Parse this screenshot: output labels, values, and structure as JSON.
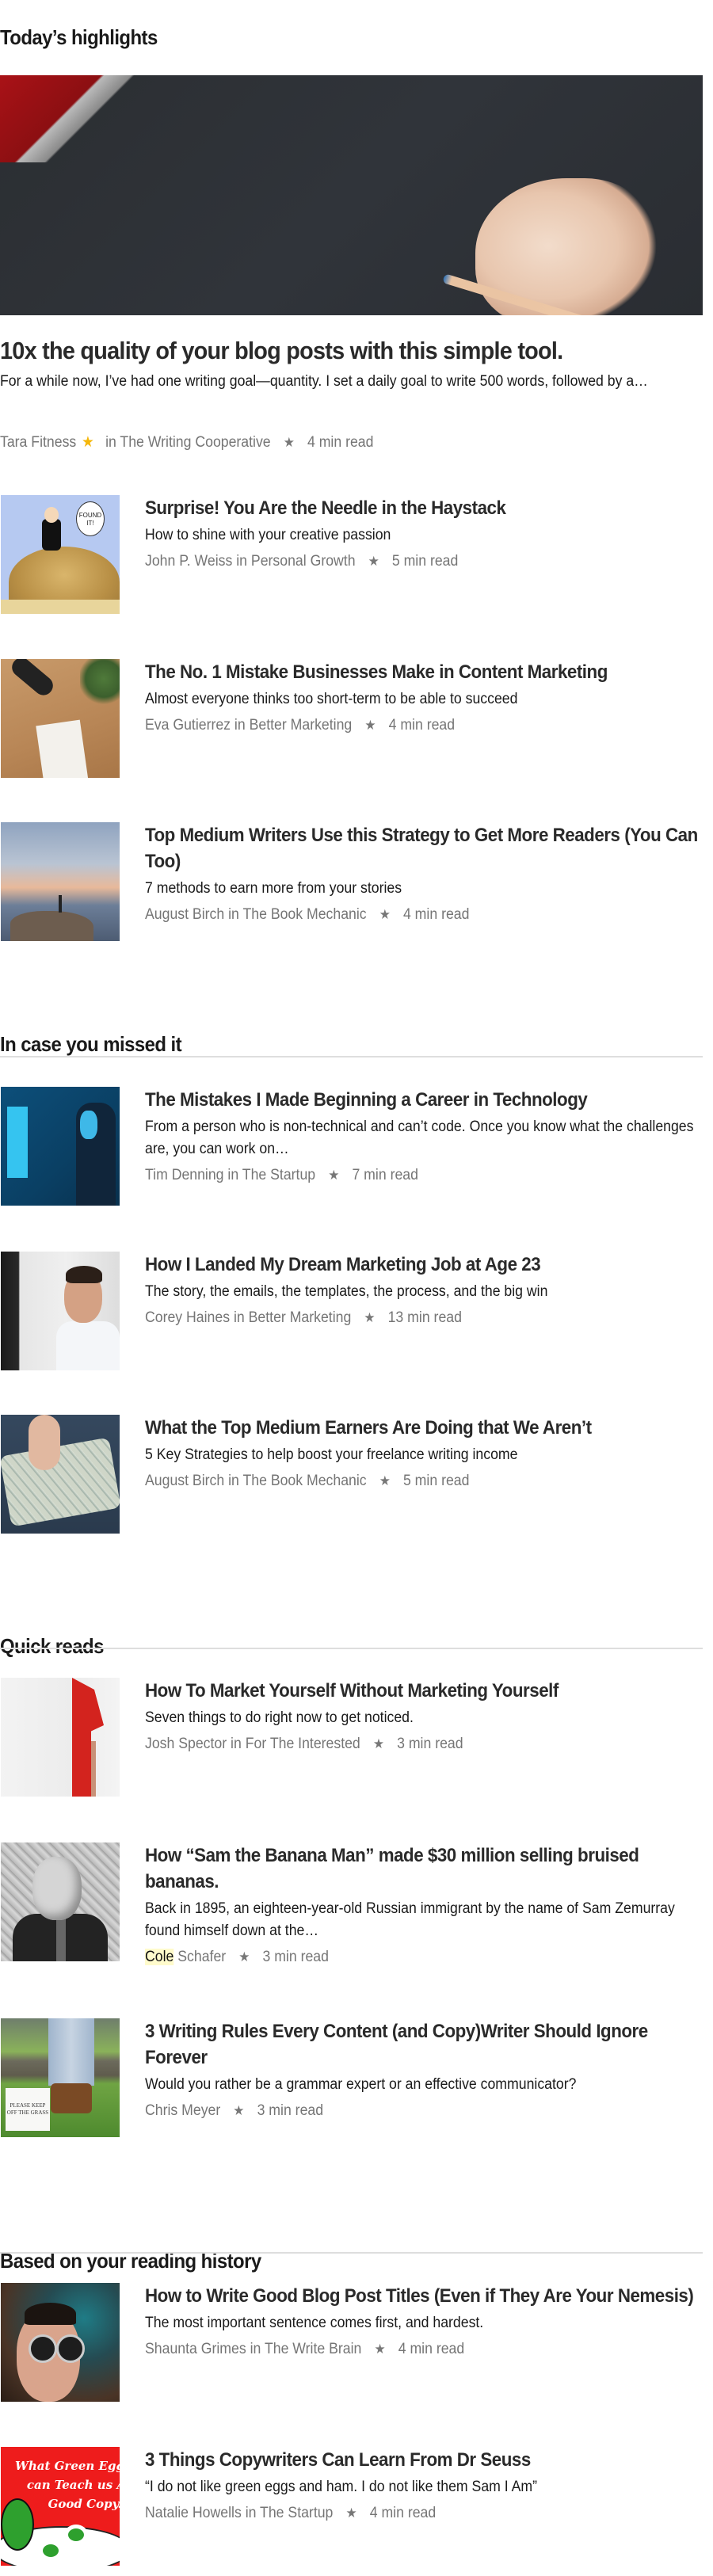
{
  "sections": [
    {
      "heading": "Today’s highlights",
      "hero": {
        "title": "10x the quality of your blog posts with this simple tool.",
        "description": "For a while now, I’ve had one writing goal—quantity. I set a daily goal to write 500 words, followed by a…",
        "author": "Tara Fitness",
        "author_badge_icon": "star-badge-icon",
        "publication_prefix": "in",
        "publication": "The Writing Cooperative",
        "separator_icon": "★",
        "read_time": "4 min read"
      },
      "items": [
        {
          "title": "Surprise! You Are the Needle in the Haystack",
          "description": "How to shine with your creative passion",
          "author": "John P. Weiss",
          "publication": "Personal Growth",
          "read_time": "5 min read",
          "thumb_text": "FOUND IT!"
        },
        {
          "title": "The No. 1 Mistake Businesses Make in Content Marketing",
          "description": "Almost everyone thinks too short-term to be able to succeed",
          "author": "Eva Gutierrez",
          "publication": "Better Marketing",
          "read_time": "4 min read"
        },
        {
          "title": "Top Medium Writers Use this Strategy to Get More Readers (You Can Too)",
          "description": "7 methods to earn more from your stories",
          "author": "August Birch",
          "publication": "The Book Mechanic",
          "read_time": "4 min read"
        }
      ]
    },
    {
      "heading": "In case you missed it",
      "items": [
        {
          "title": "The Mistakes I Made Beginning a Career in Technology",
          "description": "From a person who is non-technical and can’t code. Once you know what the challenges are, you can work on…",
          "author": "Tim Denning",
          "publication": "The Startup",
          "read_time": "7 min read"
        },
        {
          "title": "How I Landed My Dream Marketing Job at Age 23",
          "description": "The story, the emails, the templates, the process, and the big win",
          "author": "Corey Haines",
          "publication": "Better Marketing",
          "read_time": "13 min read"
        },
        {
          "title": "What the Top Medium Earners Are Doing that We Aren’t",
          "description": "5 Key Strategies to help boost your freelance writing income",
          "author": "August Birch",
          "publication": "The Book Mechanic",
          "read_time": "5 min read"
        }
      ]
    },
    {
      "heading": "Quick reads",
      "items": [
        {
          "title": "How To Market Yourself Without Marketing Yourself",
          "description": "Seven things to do right now to get noticed.",
          "author": "Josh Spector",
          "publication": "For The Interested",
          "read_time": "3 min read"
        },
        {
          "title": "How “Sam the Banana Man” made $30 million selling bruised bananas.",
          "description": "Back in 1895, an eighteen-year-old Russian immigrant by the name of Sam Zemurray found himself down at the…",
          "author_highlighted": "Cole",
          "author_rest": "Schafer",
          "read_time": "3 min read"
        },
        {
          "title": "3 Writing Rules Every Content (and Copy)Writer Should Ignore Forever",
          "description": "Would you rather be a grammar expert or an effective communicator?",
          "author": "Chris Meyer",
          "read_time": "3 min read",
          "thumb_text": "PLEASE KEEP OFF THE GRASS"
        }
      ]
    },
    {
      "heading": "Based on your reading history",
      "items": [
        {
          "title": "How to Write Good Blog Post Titles (Even if They Are Your Nemesis)",
          "description": "The most important sentence comes first, and hardest.",
          "author": "Shaunta Grimes",
          "publication": "The Write Brain",
          "read_time": "4 min read"
        },
        {
          "title": "3 Things Copywriters Can Learn From Dr Seuss",
          "description": "“I do not like green eggs and ham. I do not like them Sam I Am”",
          "author": "Natalie Howells",
          "publication": "The Startup",
          "read_time": "4 min read",
          "thumb_text": "What Green Eggs a\ncan Teach us A\nGood Copy.."
        }
      ]
    }
  ],
  "common": {
    "in": "in",
    "separator": "★"
  },
  "colors": {
    "byline_gray": "#757575",
    "title_dark": "#2a2a2a",
    "badge_gold": "#f5b70a",
    "highlight_yellow": "#fffbcc",
    "divider": "#dedede"
  }
}
